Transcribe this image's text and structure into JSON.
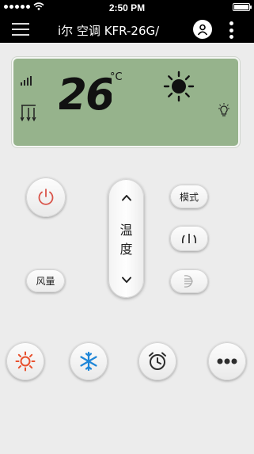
{
  "status": {
    "carrier_icon": "signal-dots",
    "wifi_icon": "wifi",
    "time": "2:50 PM",
    "battery_icon": "battery-full"
  },
  "nav": {
    "title": "i尔 空调 KFR-26G/",
    "menu_icon": "hamburger",
    "user_icon": "user",
    "more_icon": "vertical-ellipsis"
  },
  "lcd": {
    "temperature": "26",
    "unit": "°C",
    "mode_icon": "sun",
    "fan_icon": "signal-bars",
    "swing_icon": "swing-arrows",
    "light_icon": "bulb",
    "background": "#96b38c"
  },
  "controls": {
    "power_icon": "power",
    "mode_label": "模式",
    "sleep_icon": "sleep-moon",
    "fan_label": "风量",
    "swing_icon": "swing",
    "temp_label_line1": "温",
    "temp_label_line2": "度",
    "temp_up_icon": "chevron-up",
    "temp_down_icon": "chevron-down"
  },
  "bottom": {
    "heat_icon": "sun",
    "cool_icon": "snowflake",
    "timer_icon": "alarm-clock",
    "more_icon": "ellipsis"
  },
  "colors": {
    "power": "#d9544a",
    "heat": "#e8502d",
    "cool": "#1e86d8",
    "dark": "#2d2d2d"
  }
}
